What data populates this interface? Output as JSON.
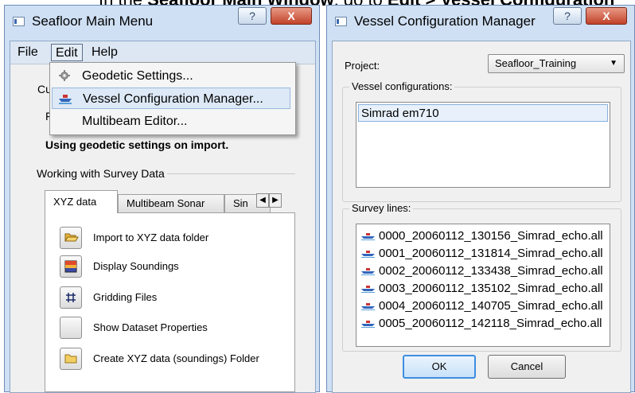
{
  "caption": {
    "pre": "In the ",
    "bold1": "Seafloor Main Window",
    "mid": ", go to ",
    "bold2": "Edit > Vessel Configuration"
  },
  "main_window": {
    "title": "Seafloor Main Menu",
    "menubar": [
      "File",
      "Edit",
      "Help"
    ],
    "edit_menu": [
      {
        "label": "Geodetic Settings...",
        "icon": "gear-icon"
      },
      {
        "label": "Vessel Configuration Manager...",
        "icon": "ship-icon"
      },
      {
        "label": "Multibeam Editor..."
      }
    ],
    "partial_text_1": "Cu",
    "partial_text_2": "F",
    "geodetic_note": "Using geodetic settings on import.",
    "group_label": "Working with Survey Data",
    "tabs": [
      "XYZ data",
      "Multibeam Sonar",
      "Sin"
    ],
    "actions": [
      {
        "label": "Import to XYZ data folder",
        "icon": "folder-open-icon"
      },
      {
        "label": "Display Soundings",
        "icon": "soundings-map-icon"
      },
      {
        "label": "Gridding Files",
        "icon": "grid-icon"
      },
      {
        "label": "Show Dataset Properties",
        "icon": ""
      },
      {
        "label": "Create XYZ data (soundings) Folder",
        "icon": "folder-icon"
      }
    ]
  },
  "vessel_window": {
    "title": "Vessel Configuration Manager",
    "project_label": "Project:",
    "project_value": "Seafloor_Training",
    "configs_label": "Vessel configurations:",
    "configs": [
      "Simrad em710"
    ],
    "survey_label": "Survey lines:",
    "survey_lines": [
      "0000_20060112_130156_Simrad_echo.all",
      "0001_20060112_131814_Simrad_echo.all",
      "0002_20060112_133438_Simrad_echo.all",
      "0003_20060112_135102_Simrad_echo.all",
      "0004_20060112_140705_Simrad_echo.all",
      "0005_20060112_142118_Simrad_echo.all"
    ],
    "ok_label": "OK",
    "cancel_label": "Cancel"
  },
  "titlebar_buttons": {
    "help": "?",
    "close": "X"
  },
  "colors": {
    "window_frame": "#cfe0f4",
    "highlight": "#dde9f6",
    "default_button": "#3d8ee0"
  }
}
